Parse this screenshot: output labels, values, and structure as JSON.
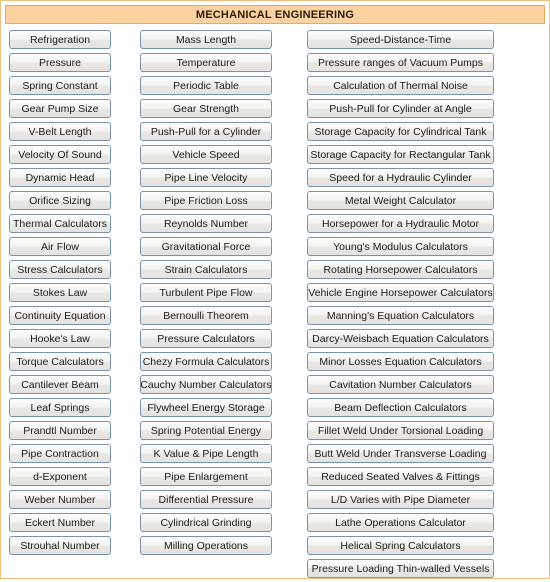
{
  "header": {
    "title": "MECHANICAL ENGINEERING",
    "bar_color": "#fbd2a0",
    "bar_border_color": "#e8a95e",
    "page_border_color": "#f0c080"
  },
  "button_style": {
    "border_color": "#7b92ac",
    "face_color": "#eeeeec",
    "text_color": "#1c1c1c"
  },
  "columns": [
    {
      "name": "column-1",
      "items": [
        "Refrigeration",
        "Pressure",
        "Spring Constant",
        "Gear Pump Size",
        "V-Belt Length",
        "Velocity Of Sound",
        "Dynamic Head",
        "Orifice Sizing",
        "Thermal Calculators",
        "Air Flow",
        "Stress Calculators",
        "Stokes Law",
        "Continuity Equation",
        "Hooke's Law",
        "Torque Calculators",
        "Cantilever Beam",
        "Leaf Springs",
        "Prandtl Number",
        "Pipe Contraction",
        "d-Exponent",
        "Weber Number",
        "Eckert Number",
        "Strouhal Number"
      ]
    },
    {
      "name": "column-2",
      "items": [
        "Mass Length",
        "Temperature",
        "Periodic Table",
        "Gear Strength",
        "Push-Pull for a Cylinder",
        "Vehicle Speed",
        "Pipe Line Velocity",
        "Pipe Friction Loss",
        "Reynolds Number",
        "Gravitational Force",
        "Strain Calculators",
        "Turbulent Pipe Flow",
        "Bernoulli Theorem",
        "Pressure Calculators",
        "Chezy Formula Calculators",
        "Cauchy Number Calculators",
        "Flywheel Energy Storage",
        "Spring Potential Energy",
        "K Value & Pipe Length",
        "Pipe Enlargement",
        "Differential Pressure",
        "Cylindrical Grinding",
        "Milling Operations"
      ]
    },
    {
      "name": "column-3",
      "items": [
        "Speed-Distance-Time",
        "Pressure ranges of Vacuum Pumps",
        "Calculation of Thermal Noise",
        "Push-Pull for Cylinder at Angle",
        "Storage Capacity for Cylindrical Tank",
        "Storage Capacity for Rectangular Tank",
        "Speed for a Hydraulic Cylinder",
        "Metal Weight Calculator",
        "Horsepower for a Hydraulic Motor",
        "Young's Modulus Calculators",
        "Rotating Horsepower Calculators",
        "Vehicle Engine Horsepower Calculators",
        "Manning's Equation Calculators",
        "Darcy-Weisbach Equation Calculators",
        "Minor Losses Equation Calculators",
        "Cavitation Number Calculators",
        "Beam Deflection Calculators",
        "Fillet Weld Under Torsional Loading",
        "Butt Weld Under Transverse Loading",
        "Reduced Seated Valves & Fittings",
        "L/D Varies with Pipe Diameter",
        "Lathe Operations Calculator",
        "Helical Spring Calculators",
        "Pressure Loading Thin-walled Vessels"
      ]
    }
  ]
}
